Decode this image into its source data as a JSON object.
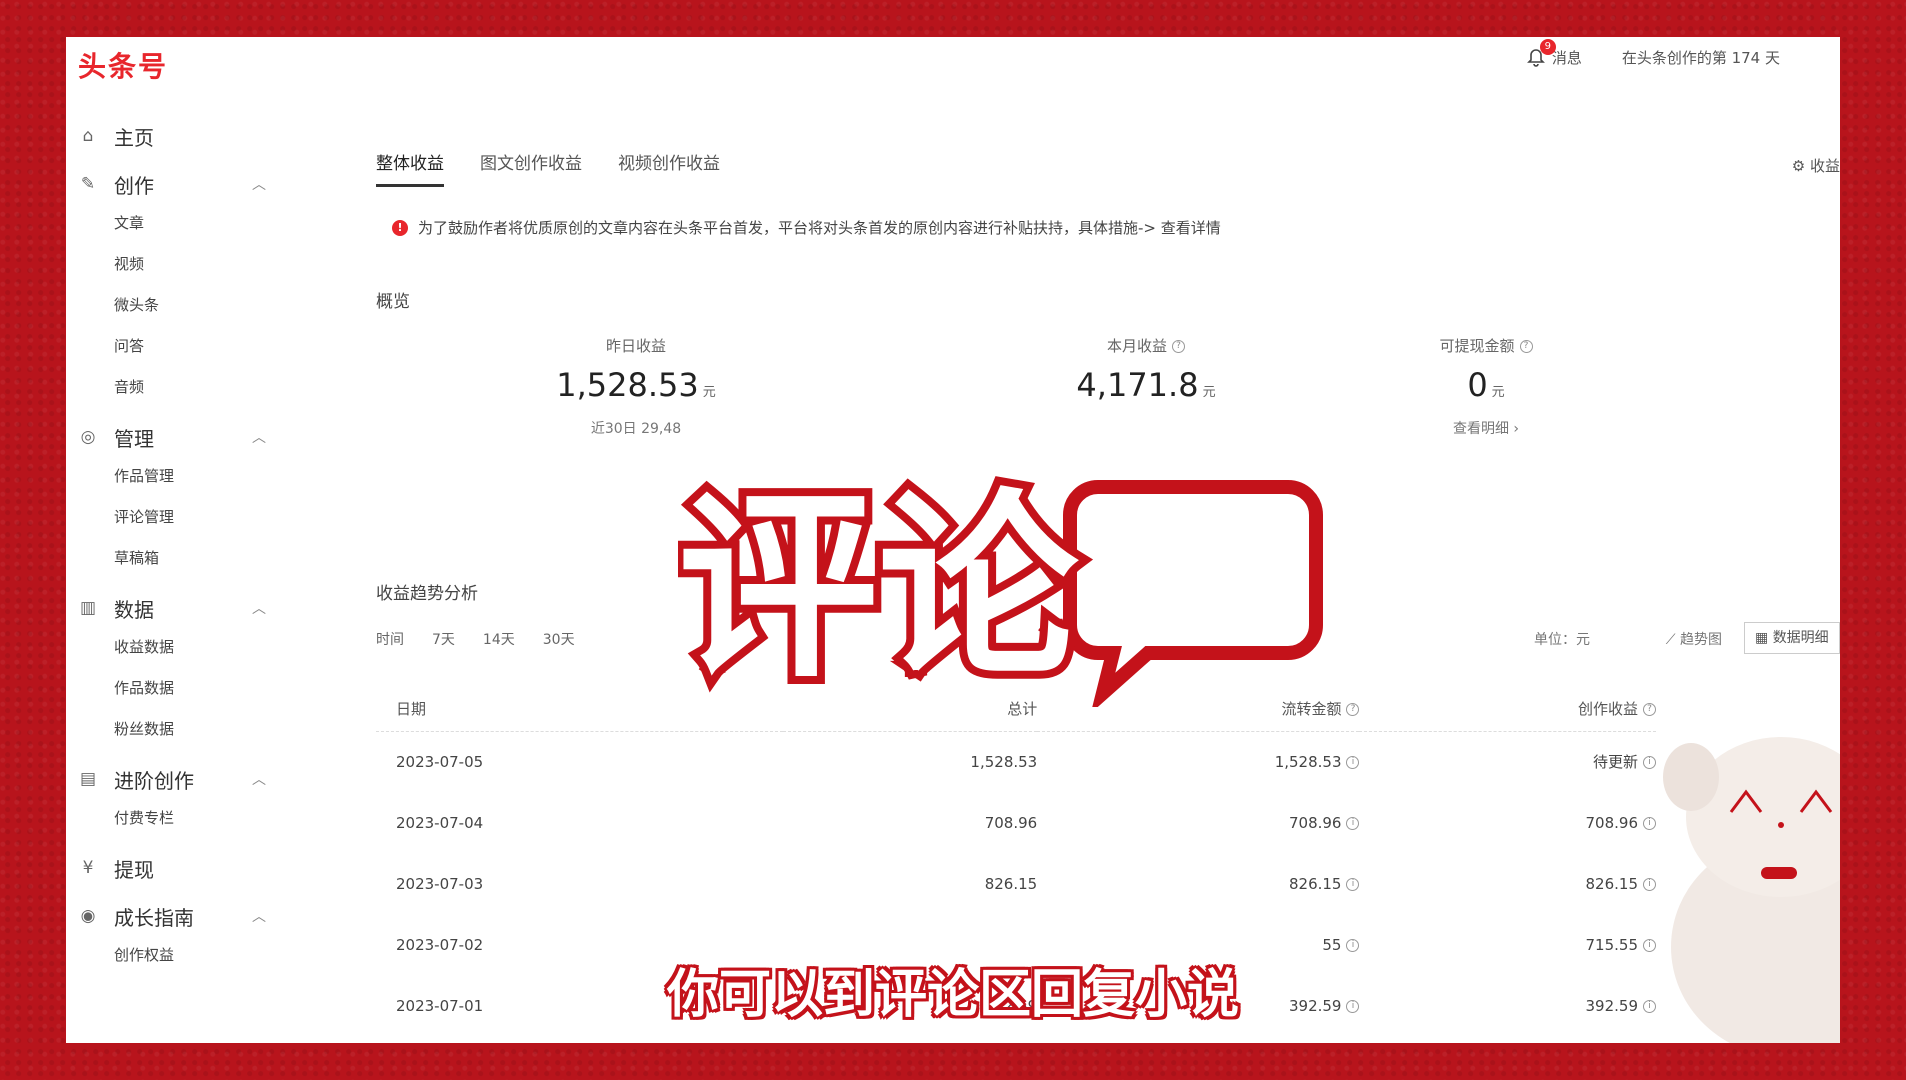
{
  "app": {
    "logo": "头条号"
  },
  "topbar": {
    "messages": "消息",
    "message_badge": "9",
    "creation_days": "在头条创作的第 174 天"
  },
  "sidebar": {
    "groups": [
      {
        "label": "主页",
        "icon": "home-icon",
        "items": []
      },
      {
        "label": "创作",
        "icon": "pen-icon",
        "items": [
          "文章",
          "视频",
          "微头条",
          "问答",
          "音频"
        ]
      },
      {
        "label": "管理",
        "icon": "manage-icon",
        "items": [
          "作品管理",
          "评论管理",
          "草稿箱"
        ]
      },
      {
        "label": "数据",
        "icon": "chart-icon",
        "items": [
          "收益数据",
          "作品数据",
          "粉丝数据"
        ]
      },
      {
        "label": "进阶创作",
        "icon": "edit-doc-icon",
        "items": [
          "付费专栏"
        ]
      },
      {
        "label": "提现",
        "icon": "coin-icon",
        "items": []
      },
      {
        "label": "成长指南",
        "icon": "growth-icon",
        "items": [
          "创作权益"
        ]
      }
    ]
  },
  "tabs": [
    "整体收益",
    "图文创作收益",
    "视频创作收益"
  ],
  "settings_label": "收益",
  "notice": "为了鼓励作者将优质原创的文章内容在头条平台首发，平台将对头条首发的原创内容进行补贴扶持，具体措施-> 查看详情",
  "overview": {
    "title": "概览",
    "yesterday": {
      "label": "昨日收益",
      "value": "1,528.53",
      "unit": "元",
      "sub": "近30日 29,48"
    },
    "month": {
      "label": "本月收益",
      "value": "4,171.8",
      "unit": "元"
    },
    "withdrawable": {
      "label": "可提现金额",
      "value": "0",
      "unit": "元",
      "sub": "查看明细 ›"
    }
  },
  "trend": {
    "title": "收益趋势分析",
    "filters": [
      "时间",
      "7天",
      "14天",
      "30天"
    ],
    "unit": "单位：元",
    "chart_button": "趋势图",
    "table_button": "数据明细"
  },
  "table": {
    "headers": [
      "日期",
      "总计",
      "流转金额",
      "创作收益"
    ],
    "rows": [
      [
        "2023-07-05",
        "1,528.53",
        "1,528.53",
        "待更新"
      ],
      [
        "2023-07-04",
        "708.96",
        "708.96",
        "708.96"
      ],
      [
        "2023-07-03",
        "826.15",
        "826.15",
        "826.15"
      ],
      [
        "2023-07-02",
        "",
        "55",
        "715.55"
      ],
      [
        "2023-07-01",
        "392.59",
        "392.59",
        "392.59"
      ]
    ]
  },
  "overlay": {
    "sticker_text": "评论",
    "subtitle": "你可以到评论区回复小说"
  }
}
